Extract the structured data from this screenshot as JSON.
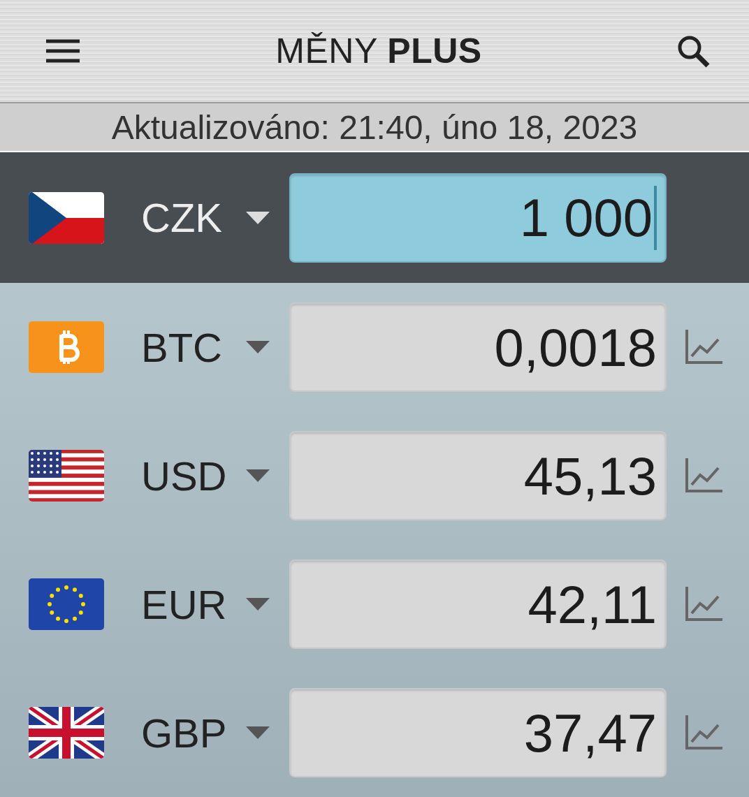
{
  "header": {
    "title": "MĚNY **PLUS**"
  },
  "updated": "Aktualizováno: 21:40, úno 18, 2023",
  "currencies": [
    {
      "kind": "cz",
      "code": "CZK",
      "value": "1 000",
      "selected": true
    },
    {
      "kind": "btc",
      "code": "BTC",
      "value": "0,0018",
      "selected": false
    },
    {
      "kind": "us",
      "code": "USD",
      "value": "45,13",
      "selected": false
    },
    {
      "kind": "eu",
      "code": "EUR",
      "value": "42,11",
      "selected": false
    },
    {
      "kind": "gb",
      "code": "GBP",
      "value": "37,47",
      "selected": false
    }
  ]
}
